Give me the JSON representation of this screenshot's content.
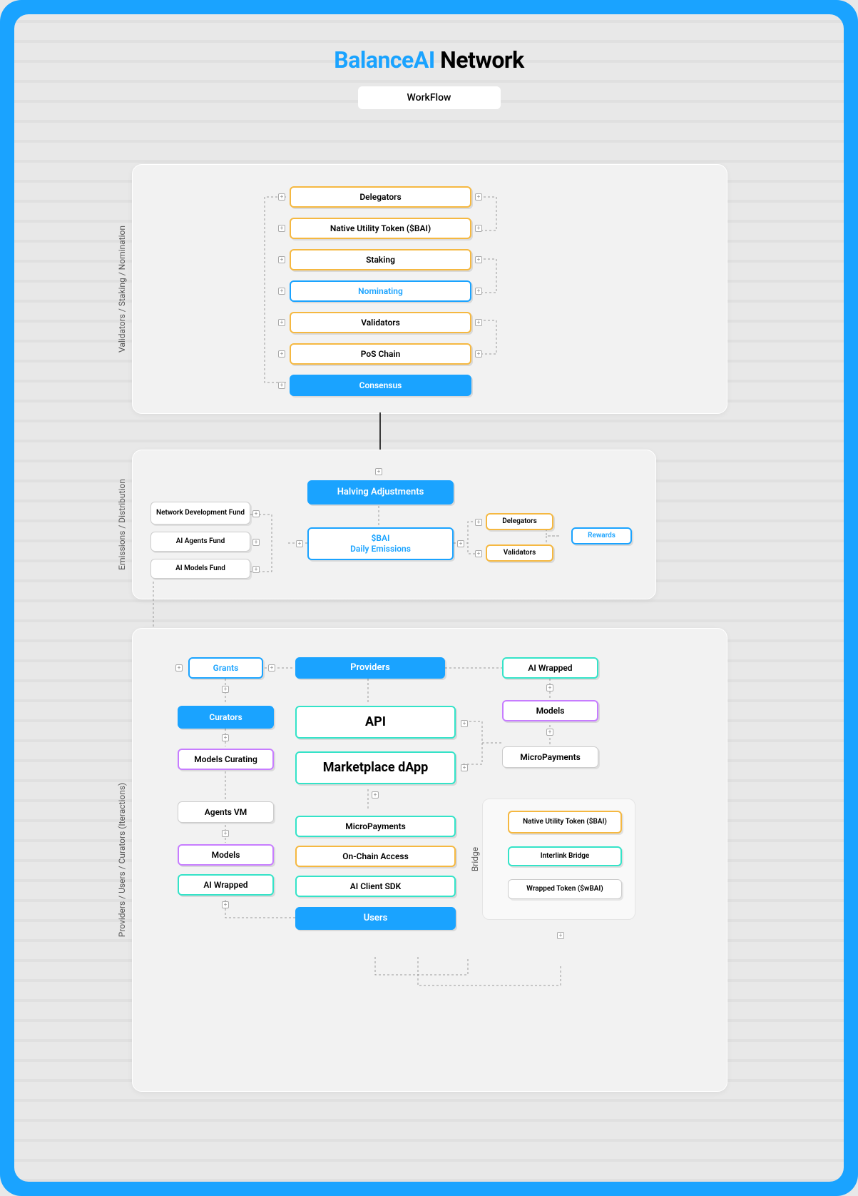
{
  "title_accent": "BalanceAI",
  "title_rest": " Network",
  "workflow_pill": "WorkFlow",
  "section1": {
    "vlabel": "Validators / Staking / Nomination",
    "nodes": {
      "delegators": "Delegators",
      "native_token": "Native Utility Token ($BAI)",
      "staking": "Staking",
      "nominating": "Nominating",
      "validators": "Validators",
      "pos_chain": "PoS Chain",
      "consensus": "Consensus"
    }
  },
  "section2": {
    "vlabel": "Emissions / Distribution",
    "halving": "Halving Adjustments",
    "emissions": "$BAI\nDaily Emissions",
    "funds": {
      "net_dev": "Network Development Fund",
      "agents": "AI Agents Fund",
      "models": "AI Models Fund"
    },
    "recipients": {
      "delegators": "Delegators",
      "validators": "Validators",
      "rewards": "Rewards"
    }
  },
  "section3": {
    "vlabel": "Providers /  Users / Curators  (Iteractions)",
    "grants": "Grants",
    "providers": "Providers",
    "curators": "Curators",
    "models_curating": "Models Curating",
    "agents_vm": "Agents VM",
    "models": "Models",
    "ai_wrapped_left": "AI Wrapped",
    "api": "API",
    "marketplace": "Marketplace dApp",
    "micropayments_center": "MicroPayments",
    "onchain_access": "On-Chain Access",
    "client_sdk": "AI Client SDK",
    "users": "Users",
    "ai_wrapped_right": "AI Wrapped",
    "models_right": "Models",
    "micropayments_right": "MicroPayments",
    "bridge": {
      "vlabel": "Bridge",
      "native": "Native Utility Token ($BAI)",
      "interlink": "Interlink Bridge",
      "wrapped": "Wrapped Token ($wBAI)"
    }
  },
  "colors": {
    "accent": "#1aa3ff",
    "orange": "#f5b841",
    "cyan": "#34e3c8",
    "magenta": "#c77dff"
  }
}
